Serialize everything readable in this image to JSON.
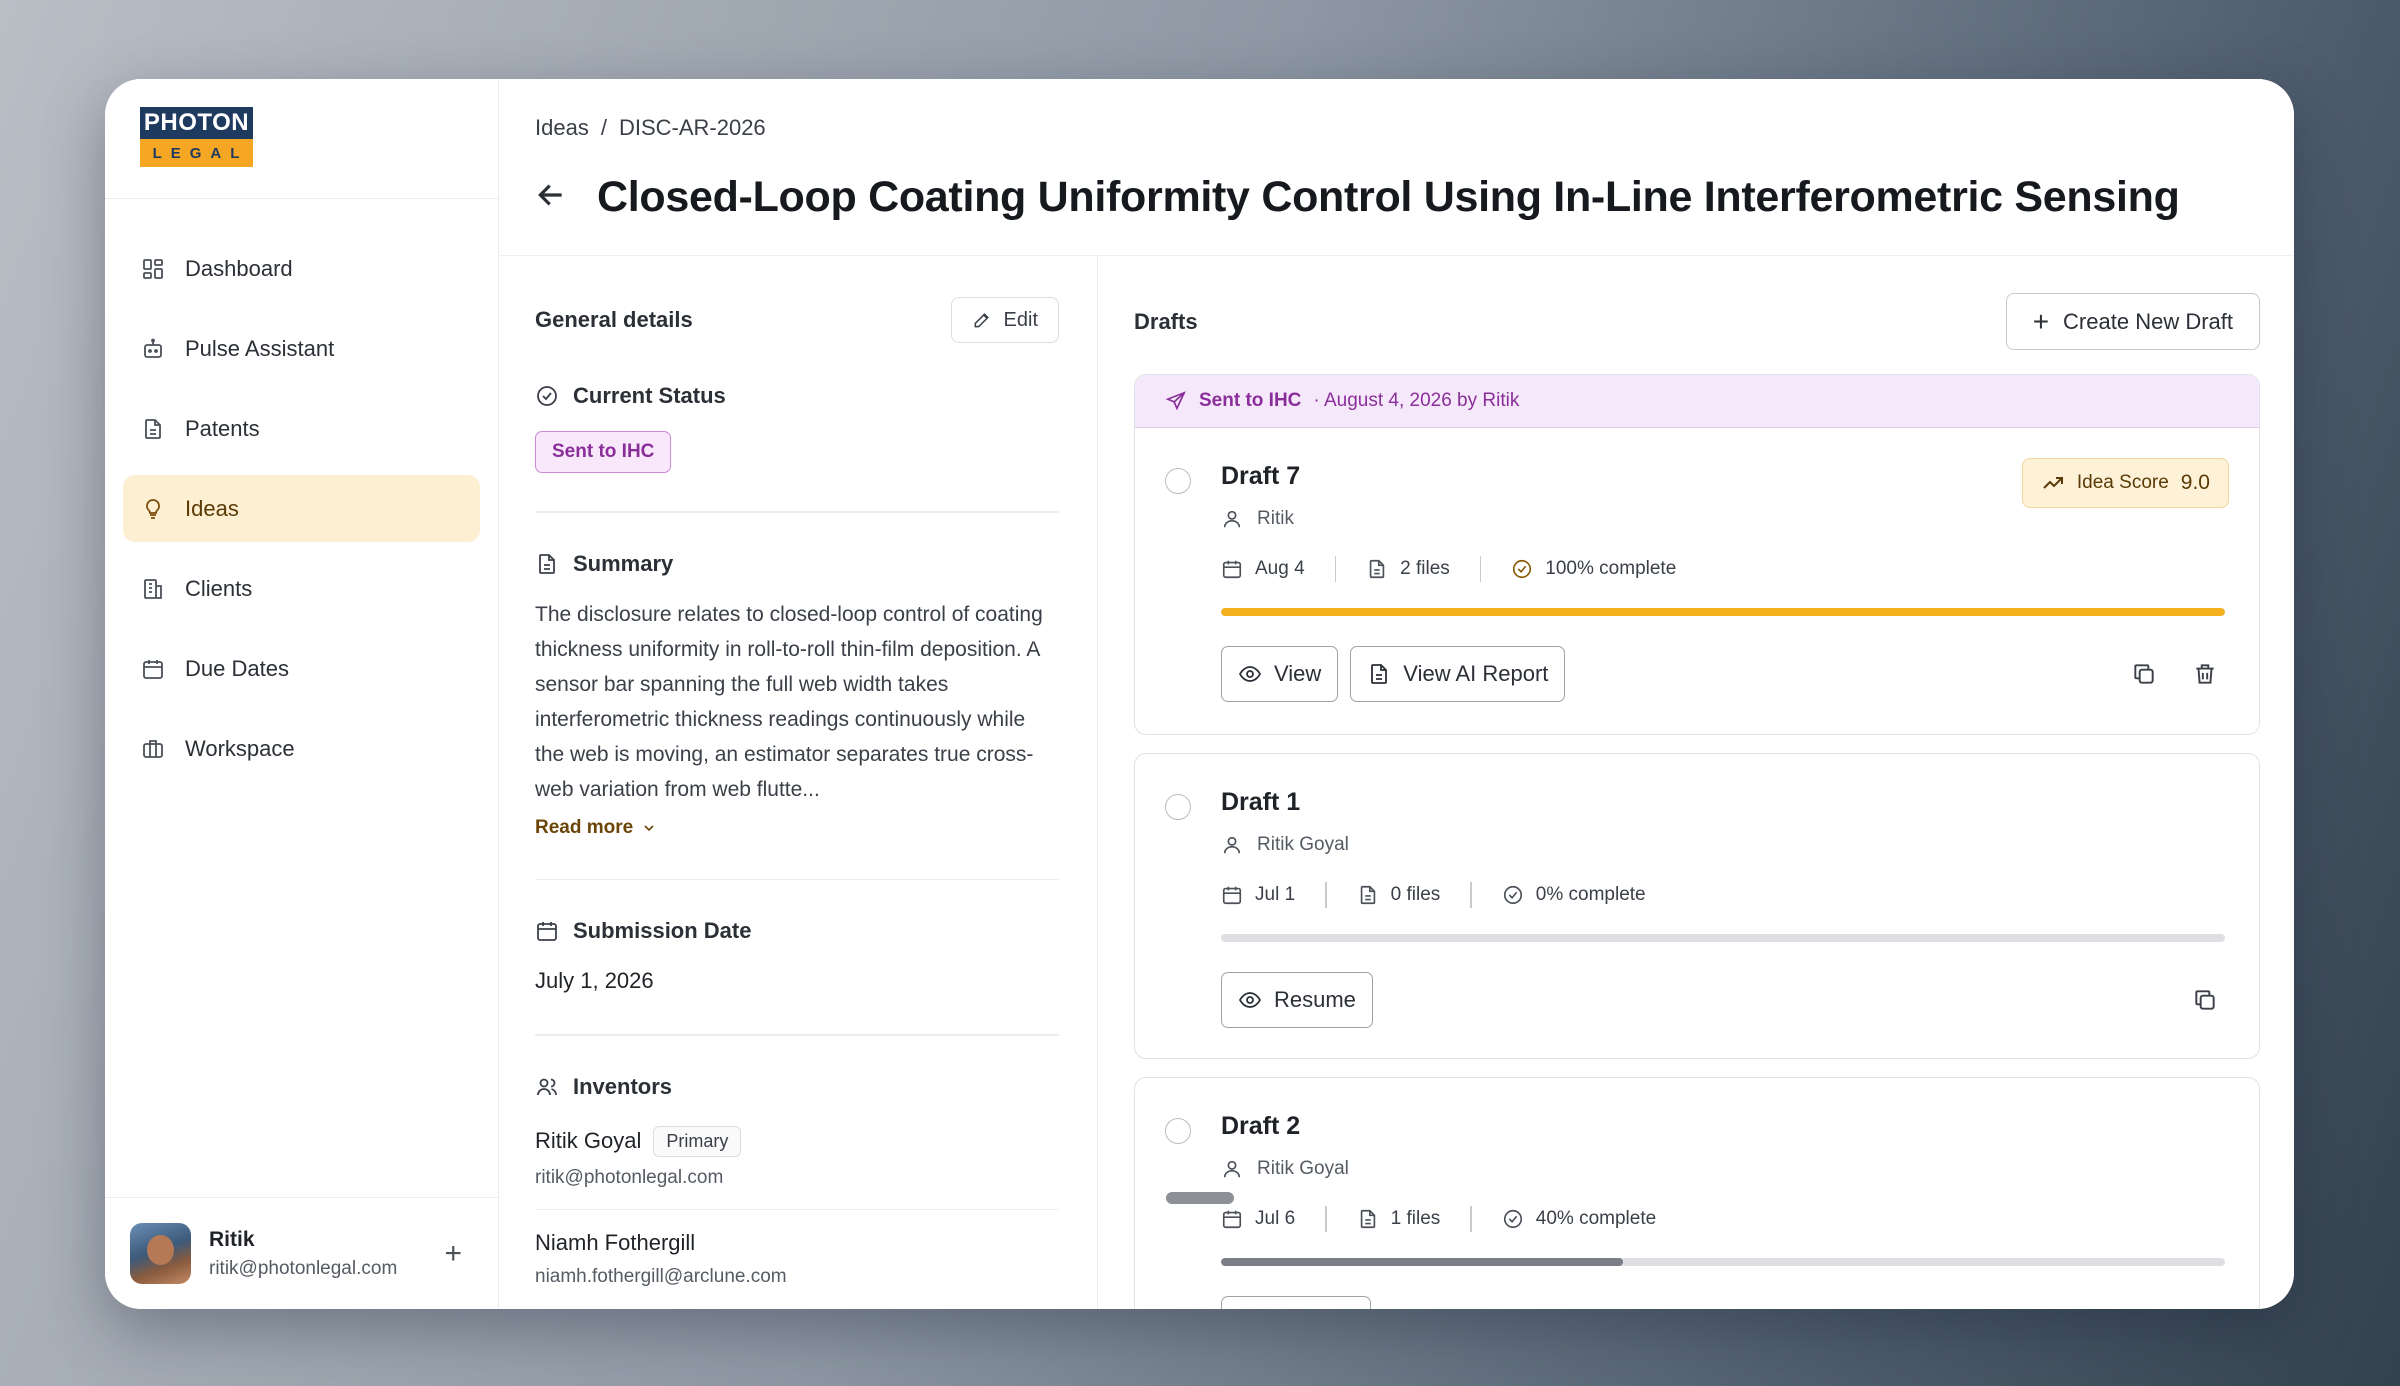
{
  "brand": {
    "line1": "PHOTON",
    "line2": "LEGAL",
    "navy": "#1f3a5f",
    "amber": "#f5a623"
  },
  "sidebar": {
    "items": [
      {
        "label": "Dashboard",
        "icon": "dashboard-icon"
      },
      {
        "label": "Pulse Assistant",
        "icon": "robot-icon"
      },
      {
        "label": "Patents",
        "icon": "document-icon"
      },
      {
        "label": "Ideas",
        "icon": "lightbulb-icon",
        "active": true
      },
      {
        "label": "Clients",
        "icon": "building-icon"
      },
      {
        "label": "Due Dates",
        "icon": "calendar-icon"
      },
      {
        "label": "Workspace",
        "icon": "briefcase-icon"
      }
    ],
    "user": {
      "name": "Ritik",
      "email": "ritik@photonlegal.com",
      "add": "+"
    }
  },
  "breadcrumb": {
    "parent": "Ideas",
    "separator": "/",
    "current": "DISC-AR-2026"
  },
  "page_title": "Closed-Loop Coating Uniformity Control Using In-Line Interferometric Sensing",
  "details": {
    "title": "General details",
    "edit_label": "Edit",
    "status": {
      "heading": "Current Status",
      "value": "Sent to IHC"
    },
    "summary": {
      "heading": "Summary",
      "text": "The disclosure relates to closed-loop control of coating thickness uniformity in roll-to-roll thin-film deposition. A sensor bar spanning the full web width takes interferometric thickness readings continuously while the web is moving, an estimator separates true cross-web variation from web flutte...",
      "read_more": "Read more"
    },
    "submission": {
      "heading": "Submission Date",
      "value": "July 1, 2026"
    },
    "inventors": {
      "heading": "Inventors",
      "list": [
        {
          "name": "Ritik Goyal",
          "badge": "Primary",
          "email": "ritik@photonlegal.com"
        },
        {
          "name": "Niamh Fothergill",
          "email": "niamh.fothergill@arclune.com"
        }
      ]
    }
  },
  "drafts": {
    "title": "Drafts",
    "create_label": "Create New Draft",
    "sent_banner": {
      "status": "Sent to IHC",
      "info": "· August 4, 2026 by Ritik"
    },
    "cards": [
      {
        "name": "Draft 7",
        "author": "Ritik",
        "date": "Aug 4",
        "files": "2 files",
        "complete": "100% complete",
        "progress": 1.0,
        "fill_color": "#f5b01e",
        "score_label": "Idea Score",
        "score": "9.0",
        "view_label": "View",
        "report_label": "View AI Report"
      },
      {
        "name": "Draft 1",
        "author": "Ritik Goyal",
        "date": "Jul 1",
        "files": "0 files",
        "complete": "0% complete",
        "progress": 0.0,
        "fill_color": "#8d9096",
        "resume_label": "Resume"
      },
      {
        "name": "Draft 2",
        "author": "Ritik Goyal",
        "date": "Jul 6",
        "files": "1 files",
        "complete": "40% complete",
        "progress": 0.4,
        "fill_color": "#7b7e85"
      }
    ]
  }
}
